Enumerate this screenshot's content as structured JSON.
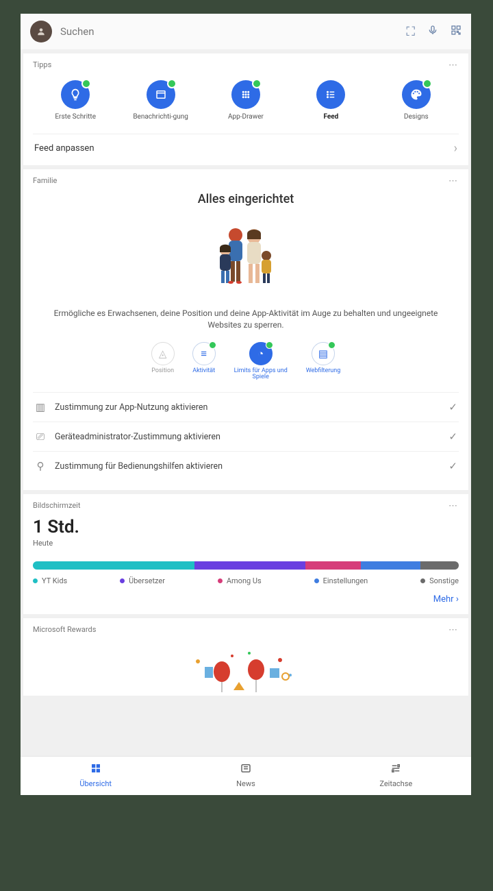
{
  "header": {
    "search_placeholder": "Suchen"
  },
  "tips": {
    "title": "Tipps",
    "items": [
      {
        "label": "Erste Schritte",
        "icon": "bulb",
        "checked": true
      },
      {
        "label": "Benachrichti-gung",
        "icon": "window",
        "checked": true
      },
      {
        "label": "App-Drawer",
        "icon": "grid",
        "checked": true
      },
      {
        "label": "Feed",
        "icon": "list",
        "bold": true,
        "checked": false
      },
      {
        "label": "Designs",
        "icon": "palette",
        "checked": true
      }
    ],
    "feed_anpassen": "Feed anpassen"
  },
  "family": {
    "title": "Familie",
    "heading": "Alles eingerichtet",
    "description": "Ermögliche es Erwachsenen, deine Position und deine App-Aktivität im Auge zu behalten und ungeeignete Websites zu sperren.",
    "items": [
      {
        "label": "Position",
        "muted": true,
        "checked": false
      },
      {
        "label": "Aktivität",
        "muted": false,
        "checked": true
      },
      {
        "label": "Limits für Apps und Spiele",
        "muted": false,
        "active": true,
        "checked": true
      },
      {
        "label": "Webfilterung",
        "muted": false,
        "checked": true
      }
    ],
    "consents": [
      {
        "label": "Zustimmung zur App-Nutzung aktivieren"
      },
      {
        "label": "Geräteadministrator-Zustimmung aktivieren"
      },
      {
        "label": "Zustimmung für Bedienungshilfen aktivieren"
      }
    ]
  },
  "screentime": {
    "title": "Bildschirmzeit",
    "value": "1 Std.",
    "sub": "Heute",
    "segments": [
      {
        "name": "YT Kids",
        "color": "#1fbfc4",
        "width": 38
      },
      {
        "name": "Übersetzer",
        "color": "#6a3fe0",
        "width": 26
      },
      {
        "name": "Among Us",
        "color": "#d63d7a",
        "width": 13
      },
      {
        "name": "Einstellungen",
        "color": "#3f7de0",
        "width": 14
      },
      {
        "name": "Sonstige",
        "color": "#6b6b6b",
        "width": 9
      }
    ],
    "more_label": "Mehr"
  },
  "rewards": {
    "title": "Microsoft Rewards"
  },
  "nav": {
    "items": [
      {
        "label": "Übersicht",
        "active": true
      },
      {
        "label": "News",
        "active": false
      },
      {
        "label": "Zeitachse",
        "active": false
      }
    ]
  },
  "colors": {
    "primary": "#2e6be6",
    "green": "#34c759"
  },
  "chart_data": {
    "type": "bar",
    "title": "Bildschirmzeit",
    "subtitle": "Heute",
    "total_label": "1 Std.",
    "series": [
      {
        "name": "YT Kids",
        "value_pct": 38,
        "color": "#1fbfc4"
      },
      {
        "name": "Übersetzer",
        "value_pct": 26,
        "color": "#6a3fe0"
      },
      {
        "name": "Among Us",
        "value_pct": 13,
        "color": "#d63d7a"
      },
      {
        "name": "Einstellungen",
        "value_pct": 14,
        "color": "#3f7de0"
      },
      {
        "name": "Sonstige",
        "value_pct": 9,
        "color": "#6b6b6b"
      }
    ]
  }
}
